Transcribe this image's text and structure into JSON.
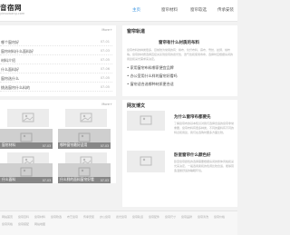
{
  "header": {
    "logo": "音宿网",
    "logo_sub": "yinsuwang.com",
    "nav": [
      "主页",
      "窗帘材料",
      "窗帘软选",
      "传承安装"
    ]
  },
  "list": {
    "more": "More+",
    "items": [
      {
        "title": "哪个窗帘好",
        "date": "07-01"
      },
      {
        "title": "窗帘材料什么面料好",
        "date": "07-03"
      },
      {
        "title": "材料介绍",
        "date": "07-05"
      },
      {
        "title": "什么面料好",
        "date": "07-06"
      },
      {
        "title": "窗帘选什么",
        "date": "07-05"
      },
      {
        "title": "挑选窗帘什么料的",
        "date": "07-05"
      }
    ]
  },
  "featured": {
    "section": "窗帘轨道",
    "title": "窗帘有什么材质的布料",
    "paragraph": "窗帘布料的种类很多，目前较为常用的有：棉布、化纤布料、麻布、雪纺、丝绸、绒布等。窗帘的材质选择直接关系到窗帘的遮光性、透气性和使用寿命，选择时应根据房间的用途和采光需求来决定。",
    "bullets": [
      "• 家用窗帘布料哪家便宜品牌",
      "• 办公室用什么样的窗帘好看吗",
      "• 窗帘适合选哪种材质更合适"
    ]
  },
  "gallery": {
    "more": "More+",
    "items": [
      {
        "caption": "窗帘材料",
        "date": "07-03"
      },
      {
        "caption": "哪种窗帘最好适用",
        "date": "07-03"
      },
      {
        "caption": "什么面料",
        "date": "07-03"
      },
      {
        "caption": "什么样的面料窗帘好看",
        "date": "07-03"
      }
    ]
  },
  "side": {
    "title": "网友博文",
    "articles": [
      {
        "title": "为什么窗帘布都要先",
        "text": "了解窗帘布的基本知识对我们选择合适的窗帘非常重要，窗帘布料有很多种类，不同的面料有不同的特点和用途，我们在选购时要多方面比较。"
      },
      {
        "title": "卧室窗帘什么颜色好",
        "text": "卧室窗帘颜色的选择需要根据房间的整体风格和采光来决定，一般选用柔和的色调比较合适，能够营造温馨舒适的睡眠环境。"
      }
    ]
  },
  "footer": {
    "links": [
      "网站首页",
      "窗帘百科",
      "窗帘材料",
      "窗帘软选",
      "布艺窗帘",
      "传承安装",
      "办公窗帘",
      "遮光窗帘",
      "窗帘轨道",
      "窗帘配件",
      "窗帘尺寸",
      "窗帘品牌",
      "窗帘清洗",
      "窗帘价格",
      "窗帘风格",
      "窗帘搭配",
      "网站地图"
    ]
  }
}
